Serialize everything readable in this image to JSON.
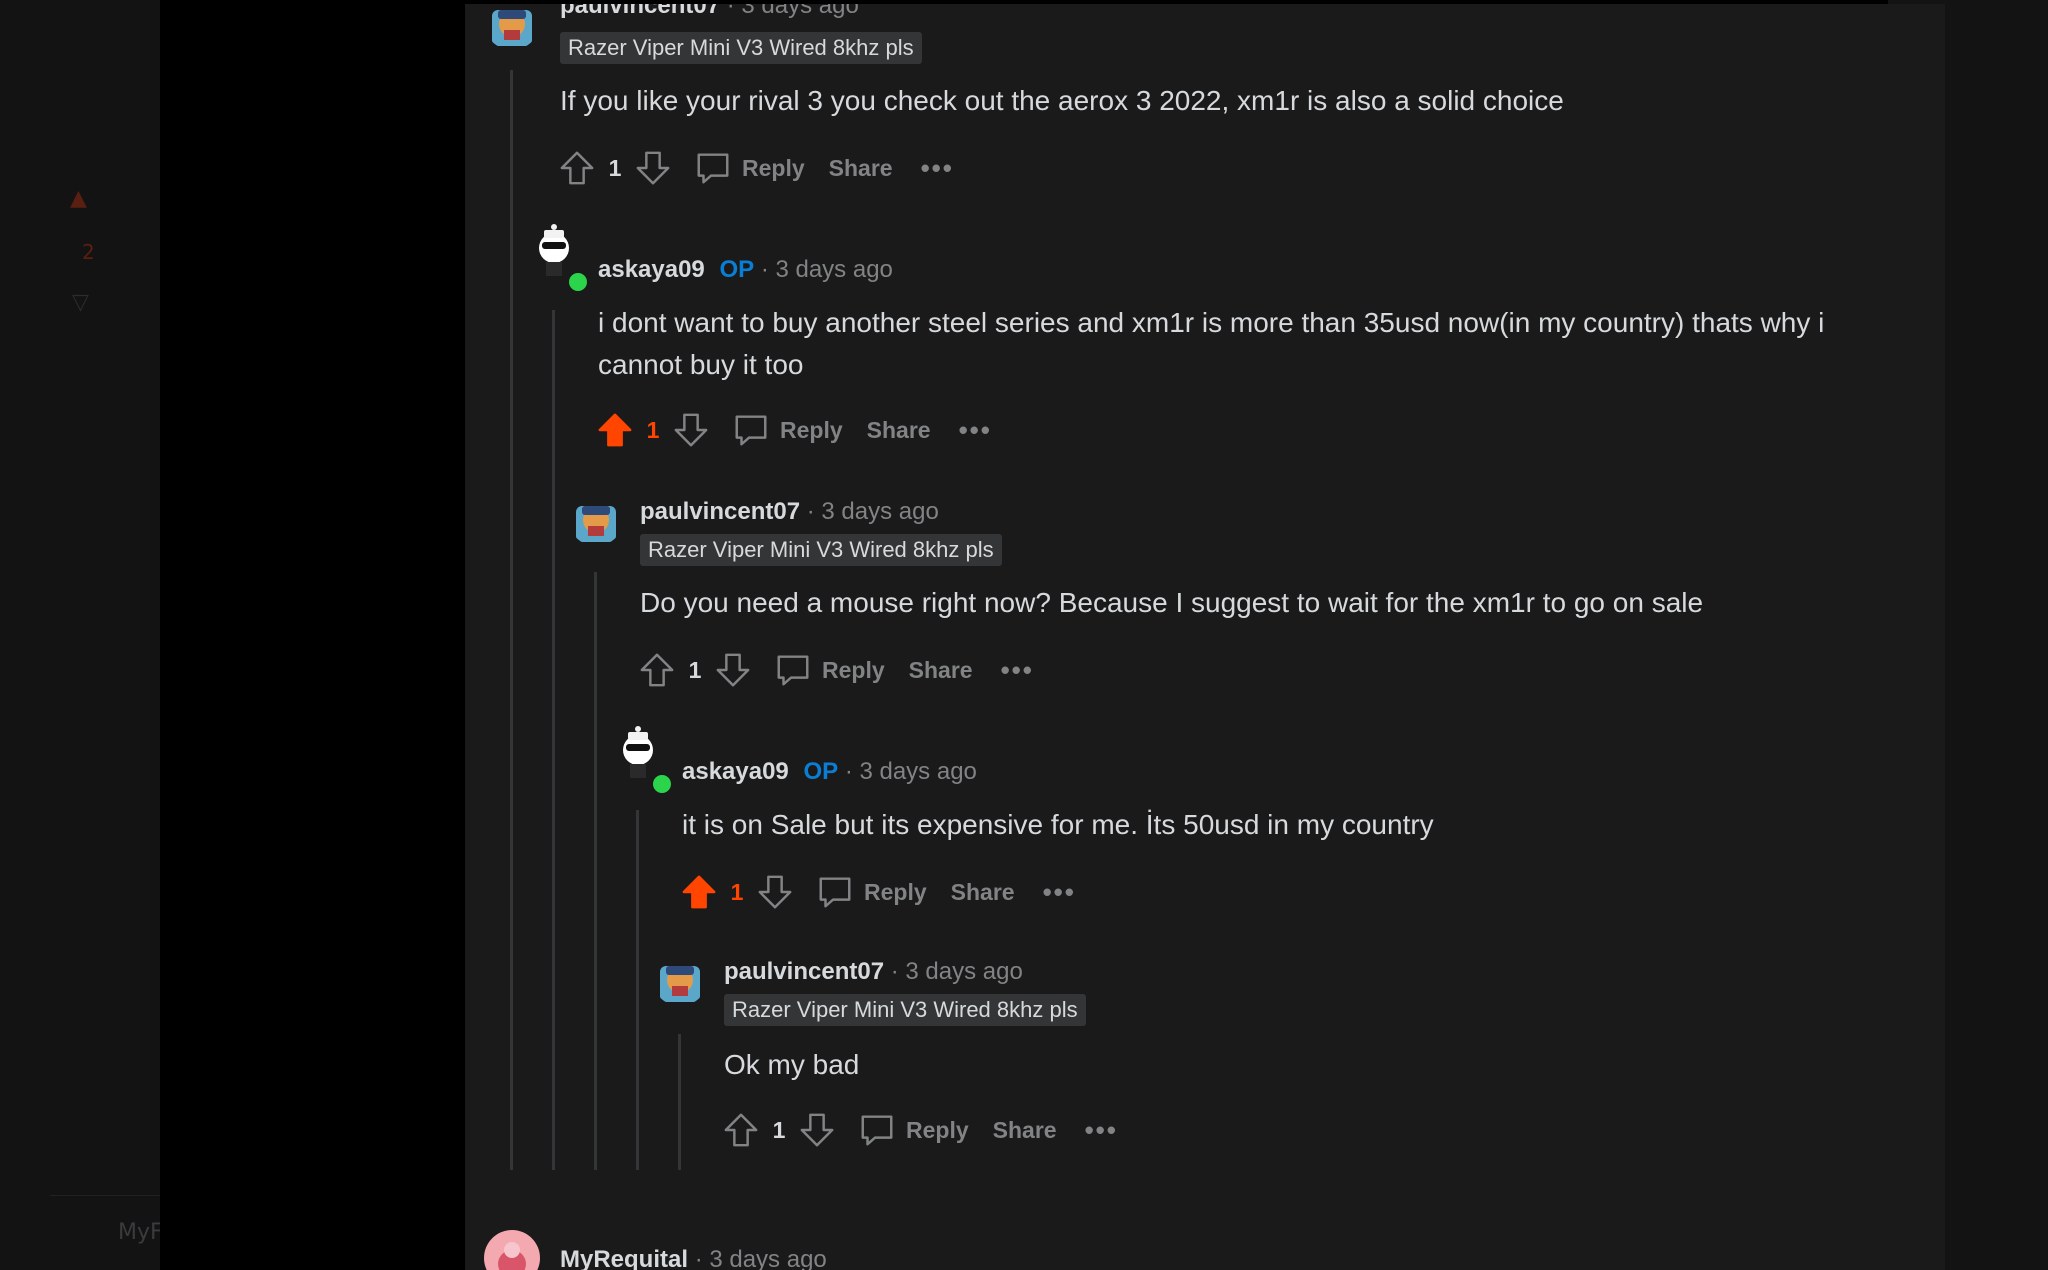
{
  "ui": {
    "op_label": "OP",
    "reply_label": "Reply",
    "share_label": "Share",
    "more_label": "•••"
  },
  "comments": [
    {
      "username": "paulvincent07",
      "time": "· 3 days ago",
      "flair": "Razer Viper Mini V3 Wired 8khz pls",
      "body": "If you like your rival 3 you check out the aerox 3 2022, xm1r is also a solid choice",
      "score": "1",
      "upvoted": false
    },
    {
      "username": "askaya09",
      "op": true,
      "time": "· 3 days ago",
      "body": "i dont want to buy another steel series and xm1r is more than 35usd now(in my country) thats why i cannot buy it too",
      "score": "1",
      "upvoted": true
    },
    {
      "username": "paulvincent07",
      "time": "· 3 days ago",
      "flair": "Razer Viper Mini V3 Wired 8khz pls",
      "body": "Do you need a mouse right now? Because I suggest to wait for the xm1r to go on sale",
      "score": "1",
      "upvoted": false
    },
    {
      "username": "askaya09",
      "op": true,
      "time": "· 3 days ago",
      "body": "it is on Sale but its expensive for me. İts 50usd in my country",
      "score": "1",
      "upvoted": true
    },
    {
      "username": "paulvincent07",
      "time": "· 3 days ago",
      "flair": "Razer Viper Mini V3 Wired 8khz pls",
      "body": "Ok my bad",
      "score": "1",
      "upvoted": false
    },
    {
      "username": "MyRequital",
      "time": "· 3 days ago"
    }
  ],
  "background": {
    "vote_count": "2",
    "label": "MyF"
  },
  "colors": {
    "upvote": "#ff4500",
    "op": "#0a7ed4",
    "online": "#2bd44b",
    "panel": "#1a1a1b",
    "meta": "#818384"
  }
}
